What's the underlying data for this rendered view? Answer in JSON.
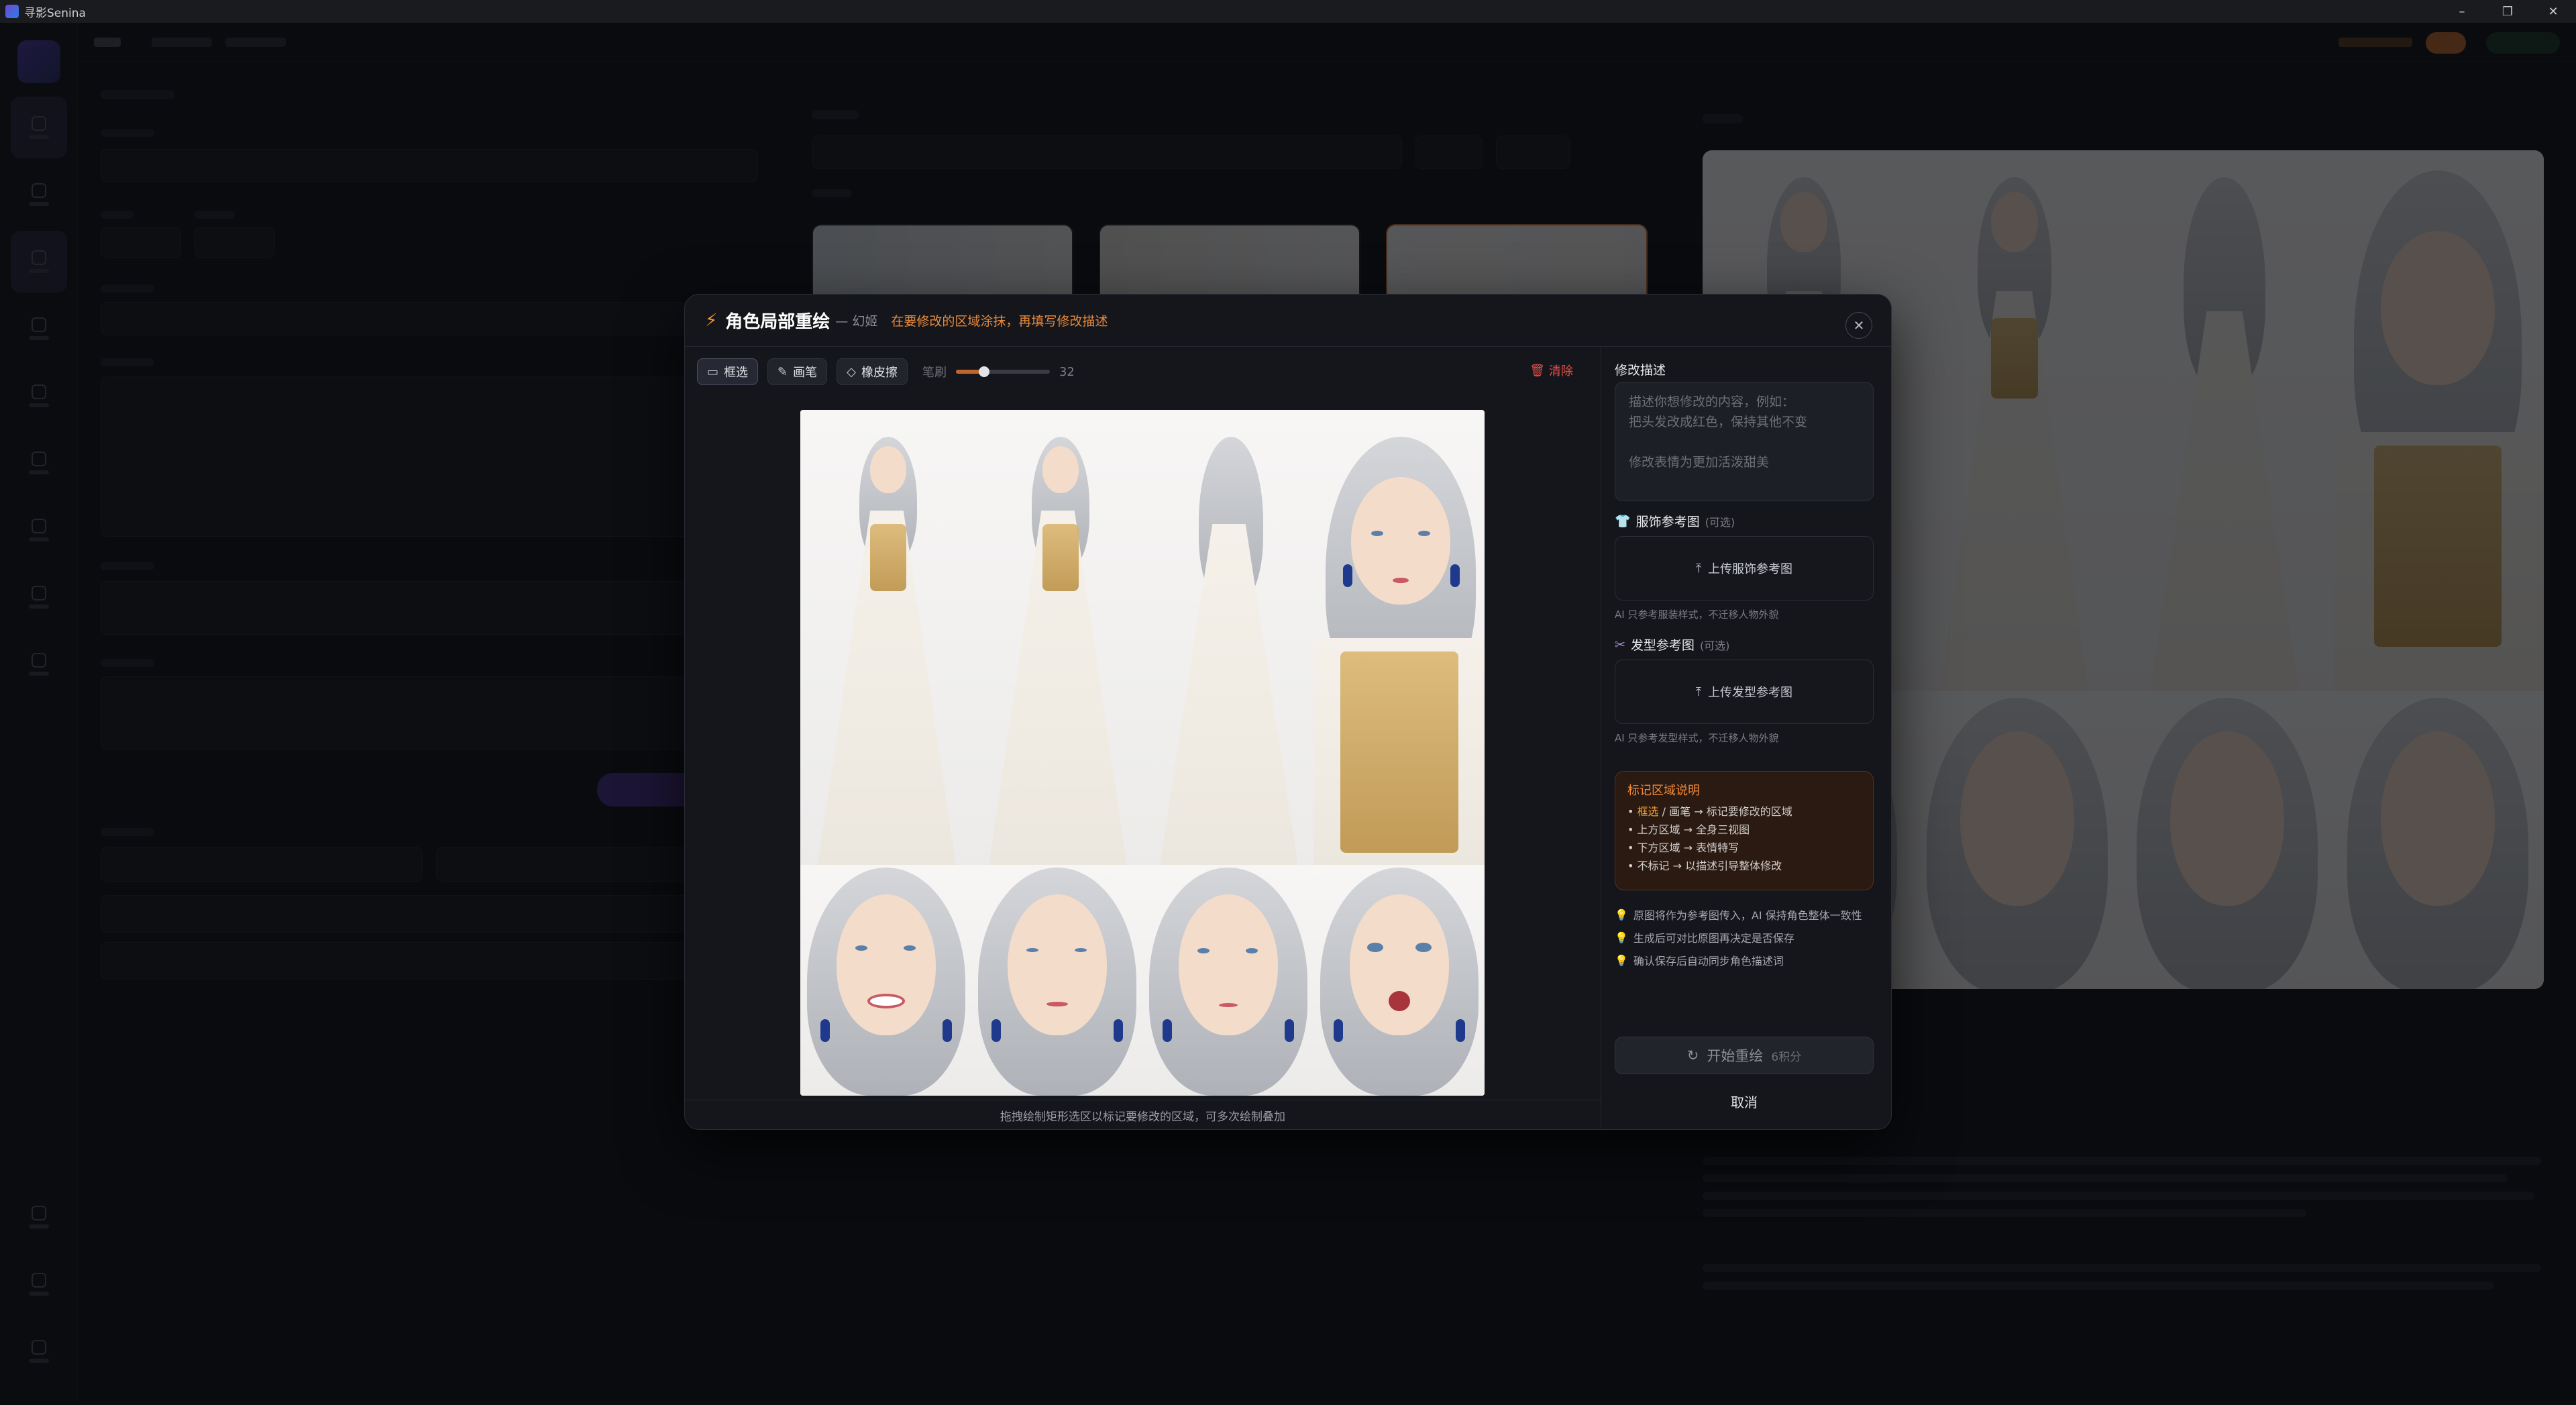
{
  "window": {
    "title": "寻影Senina",
    "controls": [
      "–",
      "❐",
      "✕"
    ]
  },
  "modal": {
    "title": "角色局部重绘",
    "subtitle": "— 幻姬",
    "hint": "在要修改的区域涂抹，再填写修改描述",
    "close_label": "✕",
    "toolbar": {
      "tools": [
        {
          "icon": "rect-select-icon",
          "glyph": "▭",
          "label": "框选",
          "active": true
        },
        {
          "icon": "brush-icon",
          "glyph": "✎",
          "label": "画笔",
          "active": false
        },
        {
          "icon": "eraser-icon",
          "glyph": "◇",
          "label": "橡皮擦",
          "active": false
        }
      ],
      "brush_label": "笔刷",
      "brush_size": "32",
      "brush_fraction": 0.3,
      "clear_label": "清除"
    },
    "canvas_footer": "拖拽绘制矩形选区以标记要修改的区域，可多次绘制叠加",
    "side": {
      "edit_label": "修改描述",
      "edit_placeholder": "描述你想修改的内容，例如：\n把头发改成红色，保持其他不变\n\n修改表情为更加活泼甜美\n\n\n帮我改为紫色衣服",
      "outfit": {
        "label": "服饰参考图",
        "optional": "(可选)",
        "upload_label": "上传服饰参考图",
        "note": "AI 只参考服装样式，不迁移人物外貌"
      },
      "hair": {
        "label": "发型参考图",
        "optional": "(可选)",
        "upload_label": "上传发型参考图",
        "note": "AI 只参考发型样式，不迁移人物外貌"
      },
      "marking": {
        "title": "标记区域说明",
        "lines": [
          {
            "pre": "• ",
            "hl": "框选",
            "post": " / 画笔 → 标记要修改的区域"
          },
          {
            "pre": "• ",
            "hl": "",
            "post": "上方区域 → 全身三视图"
          },
          {
            "pre": "• ",
            "hl": "",
            "post": "下方区域 → 表情特写"
          },
          {
            "pre": "• ",
            "hl": "",
            "post": "不标记 → 以描述引导整体修改"
          }
        ]
      },
      "tips": [
        "原图将作为参考图传入，AI 保持角色整体一致性",
        "生成后可对比原图再决定是否保存",
        "确认保存后自动同步角色描述词"
      ],
      "start_label": "开始重绘",
      "start_cost": "6积分",
      "cancel_label": "取消"
    }
  },
  "colors": {
    "accent": "#f39b3b",
    "danger": "#e0504a",
    "modal_bg": "#15161b"
  }
}
